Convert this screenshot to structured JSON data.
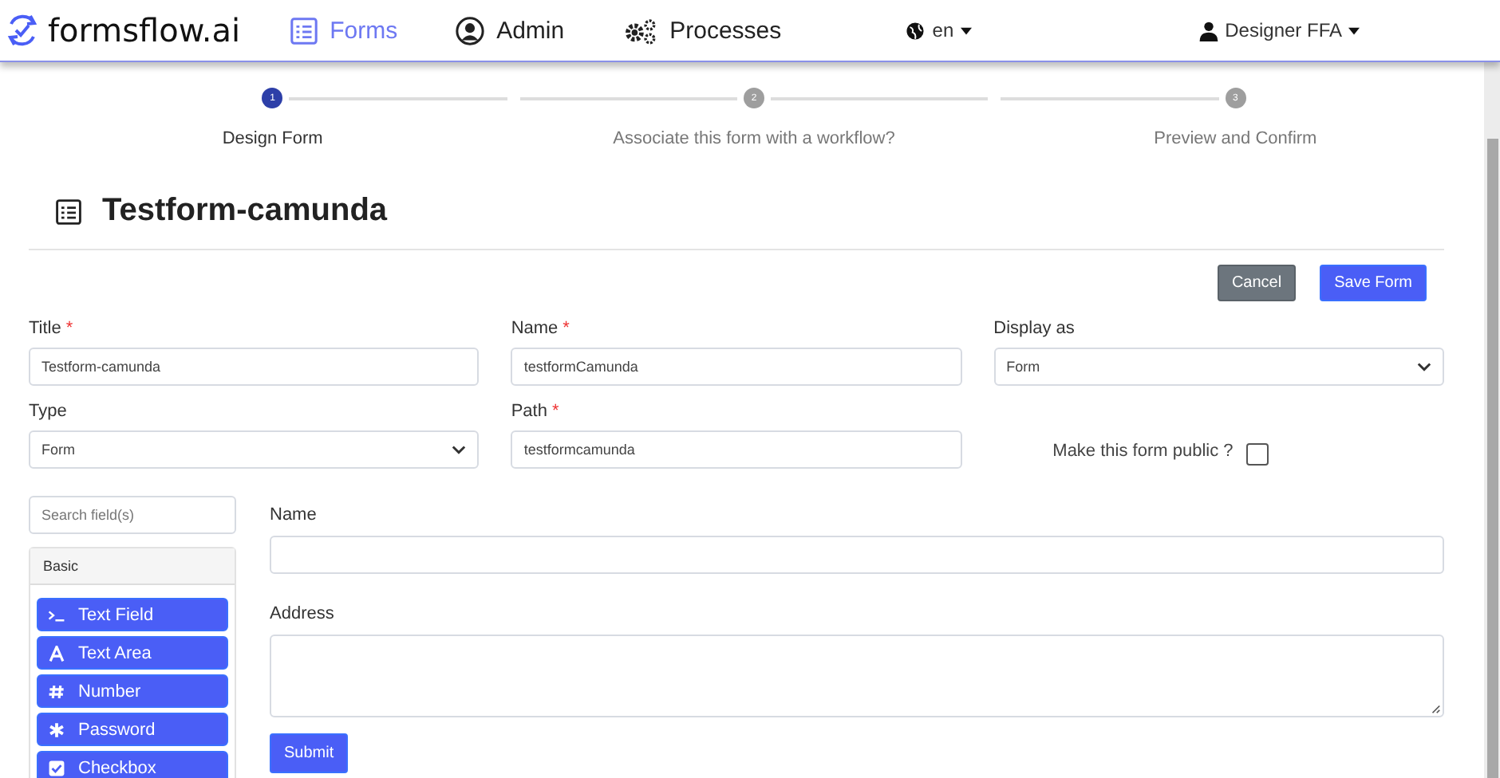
{
  "navbar": {
    "brand": "formsflow.ai",
    "items": [
      {
        "label": "Forms",
        "kind": "forms",
        "selected": true
      },
      {
        "label": "Admin",
        "kind": "admin",
        "selected": false
      },
      {
        "label": "Processes",
        "kind": "processes",
        "selected": false
      }
    ],
    "language": "en",
    "user": "Designer FFA"
  },
  "steps": [
    {
      "number": "1",
      "label": "Design Form",
      "selected": true
    },
    {
      "number": "2",
      "label": "Associate this form with a workflow?",
      "selected": false
    },
    {
      "number": "3",
      "label": "Preview and Confirm",
      "selected": false
    }
  ],
  "page_title": "Testform-camunda",
  "actions": [
    {
      "label": "Cancel",
      "kind": "secondary"
    },
    {
      "label": "Save Form",
      "kind": "primary"
    }
  ],
  "fields": [
    {
      "label": "Title",
      "required_mark": "*",
      "kind": "input",
      "value": "Testform-camunda"
    },
    {
      "label": "Name",
      "required_mark": "*",
      "kind": "input",
      "value": "testformCamunda"
    },
    {
      "label": "Display as",
      "kind": "select",
      "value": "Form"
    },
    {
      "label": "Type",
      "kind": "select",
      "value": "Form"
    },
    {
      "label": "Path",
      "required_mark": "*",
      "kind": "input",
      "value": "testformcamunda"
    }
  ],
  "public_option": {
    "label": "Make this form public ?",
    "checked": false
  },
  "builder": {
    "search": {
      "placeholder": "Search field(s)"
    },
    "group": "Basic",
    "components": [
      {
        "label": "Text Field",
        "kind": "textfield"
      },
      {
        "label": "Text Area",
        "kind": "textarea"
      },
      {
        "label": "Number",
        "kind": "number"
      },
      {
        "label": "Password",
        "kind": "password"
      },
      {
        "label": "Checkbox",
        "kind": "checkbox"
      }
    ]
  },
  "preview": {
    "fields": [
      {
        "label": "Name",
        "kind": "input"
      },
      {
        "label": "Address",
        "kind": "textarea"
      }
    ],
    "submit": "Submit"
  }
}
